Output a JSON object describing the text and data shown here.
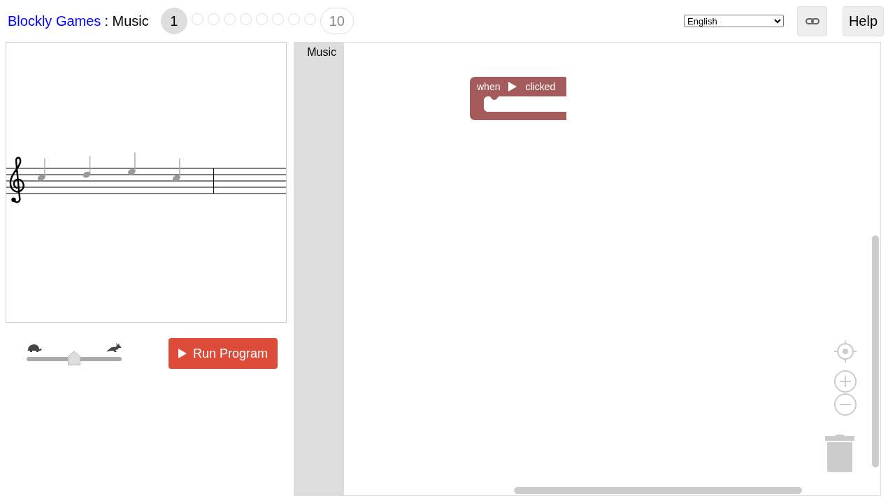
{
  "header": {
    "site_link": "Blockly Games",
    "game_title": ": Music",
    "levels": [
      {
        "label": "1",
        "selected": true
      },
      {
        "selected": false
      },
      {
        "selected": false
      },
      {
        "selected": false
      },
      {
        "selected": false
      },
      {
        "selected": false
      },
      {
        "selected": false
      },
      {
        "selected": false
      },
      {
        "selected": false
      },
      {
        "label": "10",
        "selected": false
      }
    ],
    "language": {
      "value": "English"
    },
    "help_button": "Help"
  },
  "speed_slider": {
    "level": 0.5
  },
  "run_button": "Run Program",
  "workspace": {
    "toolbox": [
      {
        "label": "Music",
        "selected": false
      }
    ],
    "blocks": [
      {
        "kind": "event",
        "text_before": "when",
        "text_after": "clicked"
      }
    ]
  }
}
